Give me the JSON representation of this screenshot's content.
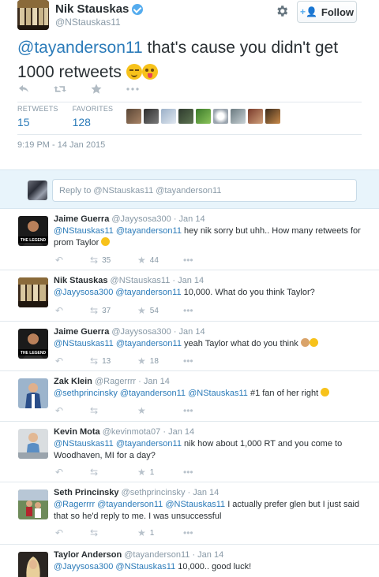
{
  "tweet": {
    "author_name": "Nik Stauskas",
    "author_handle": "@NStauskas11",
    "follow_label": "Follow",
    "mention": "@tayanderson11",
    "text": " that's cause you didn't get 1000 retweets ",
    "retweets_label": "RETWEETS",
    "retweets_count": "15",
    "favorites_label": "FAVORITES",
    "favorites_count": "128",
    "timestamp": "9:19 PM - 14 Jan 2015"
  },
  "reply_box": {
    "placeholder": "Reply to @NStauskas11 @tayanderson11"
  },
  "replies": [
    {
      "name": "Jaime Guerra",
      "handle": "@Jayysosa300",
      "time": "· Jan 14",
      "mentions": "@NStauskas11 @tayanderson11",
      "text": " hey nik sorry but uhh.. How many retweets for prom Taylor ",
      "retweets": "35",
      "favorites": "44"
    },
    {
      "name": "Nik Stauskas",
      "handle": "@NStauskas11",
      "time": "· Jan 14",
      "mentions": "@Jayysosa300 @tayanderson11",
      "text": " 10,000. What do you think Taylor?",
      "retweets": "37",
      "favorites": "54"
    },
    {
      "name": "Jaime Guerra",
      "handle": "@Jayysosa300",
      "time": "· Jan 14",
      "mentions": "@NStauskas11 @tayanderson11",
      "text": " yeah Taylor what do you think ",
      "retweets": "13",
      "favorites": "18"
    },
    {
      "name": "Zak Klein",
      "handle": "@Ragerrrr",
      "time": "· Jan 14",
      "mentions": "@sethprincinsky @tayanderson11 @NStauskas11",
      "text": " #1 fan of her right ",
      "retweets": "",
      "favorites": ""
    },
    {
      "name": "Kevin Mota",
      "handle": "@kevinmota07",
      "time": "· Jan 14",
      "mentions": "@NStauskas11 @tayanderson11",
      "text": " nik how about 1,000 RT and you come to Woodhaven, MI for a day?",
      "retweets": "",
      "favorites": "1"
    },
    {
      "name": "Seth Princinsky",
      "handle": "@sethprincinsky",
      "time": "· Jan 14",
      "mentions": "@Ragerrrr @tayanderson11 @NStauskas11",
      "text": " I actually prefer glen but I just said that so he'd reply to me. I was unsuccessful",
      "retweets": "",
      "favorites": "1"
    },
    {
      "name": "Taylor Anderson",
      "handle": "@tayanderson11",
      "time": "· Jan 14",
      "mentions": "@Jayysosa300 @NStauskas11",
      "text": " 10,000.. good luck!",
      "retweets": "",
      "favorites": ""
    }
  ],
  "avatar_caption": "THE LEGEND"
}
